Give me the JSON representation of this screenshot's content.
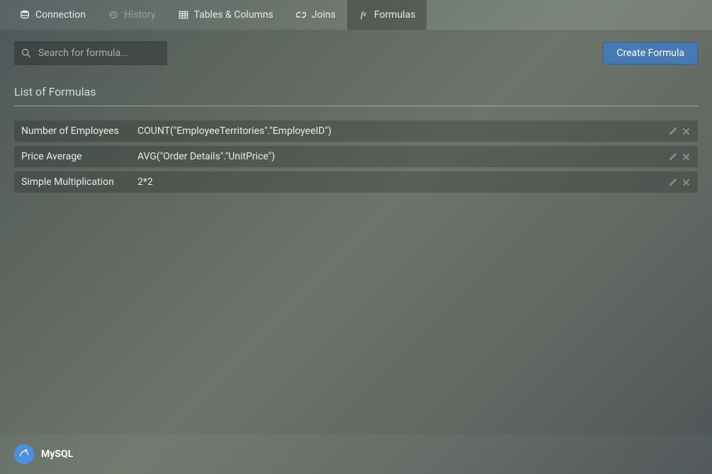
{
  "tabs": [
    {
      "label": "Connection",
      "icon": "database",
      "active": false,
      "disabled": false
    },
    {
      "label": "History",
      "icon": "history",
      "active": false,
      "disabled": true
    },
    {
      "label": "Tables & Columns",
      "icon": "table",
      "active": false,
      "disabled": false
    },
    {
      "label": "Joins",
      "icon": "link",
      "active": false,
      "disabled": false
    },
    {
      "label": "Formulas",
      "icon": "fx",
      "active": true,
      "disabled": false
    }
  ],
  "search": {
    "placeholder": "Search for formula..."
  },
  "buttons": {
    "create": "Create Formula"
  },
  "section": {
    "title": "List of Formulas"
  },
  "formulas": [
    {
      "name": "Number of Employees",
      "expression": "COUNT(\"EmployeeTerritories\".\"EmployeeID\")"
    },
    {
      "name": "Price Average",
      "expression": "AVG(\"Order Details\".\"UnitPrice\")"
    },
    {
      "name": "Simple Multiplication",
      "expression": "2*2"
    }
  ],
  "footer": {
    "connectionName": "MySQL"
  }
}
